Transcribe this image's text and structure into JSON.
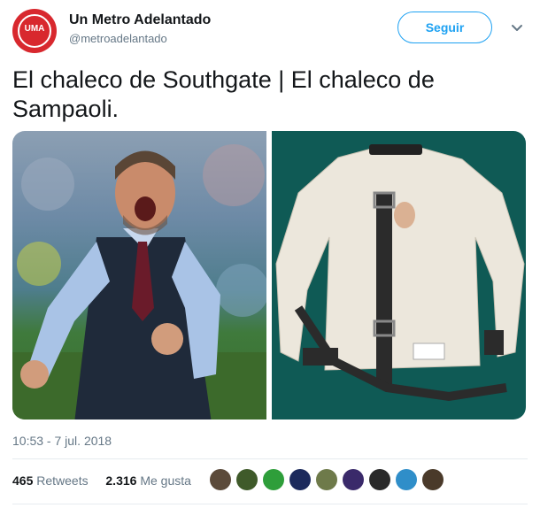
{
  "account": {
    "name": "Un Metro Adelantado",
    "handle": "@metroadelantado",
    "avatar_text": "UMA"
  },
  "follow_label": "Seguir",
  "tweet": {
    "text_line1": "El chaleco de Southgate | El chaleco de",
    "text_line2": "Sampaoli."
  },
  "timestamp": "10:53 - 7 jul. 2018",
  "stats": {
    "retweets_count": "465",
    "retweets_label": "Retweets",
    "likes_count": "2.316",
    "likes_label": "Me gusta"
  },
  "likers": [
    {
      "color": "#5b4a3a"
    },
    {
      "color": "#3f5a2a"
    },
    {
      "color": "#2e9e3a"
    },
    {
      "color": "#1c2a5c"
    },
    {
      "color": "#6e7a4a"
    },
    {
      "color": "#3a2a6a"
    },
    {
      "color": "#2a2a2a"
    },
    {
      "color": "#2f8ec9"
    },
    {
      "color": "#4a3a2a"
    }
  ],
  "colors": {
    "accent": "#1da1f2",
    "text": "#14171a",
    "muted": "#657786"
  }
}
